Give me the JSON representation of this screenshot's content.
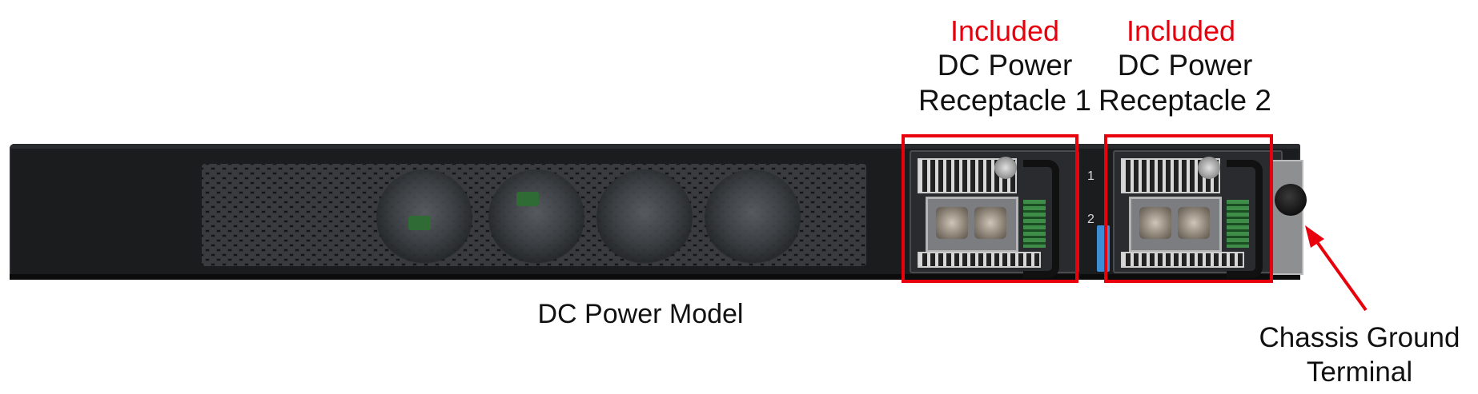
{
  "receptacle_1": {
    "status": "Included",
    "name_line1": "DC Power",
    "name_line2": "Receptacle 1"
  },
  "receptacle_2": {
    "status": "Included",
    "name_line1": "DC Power",
    "name_line2": "Receptacle 2"
  },
  "model_caption": "DC Power Model",
  "ground_label_line1": "Chassis Ground",
  "ground_label_line2": "Terminal",
  "slot_labels": [
    "1",
    "2"
  ],
  "colors": {
    "highlight": "#e8000d",
    "chassis": "#1b1c1e",
    "text": "#111111"
  }
}
